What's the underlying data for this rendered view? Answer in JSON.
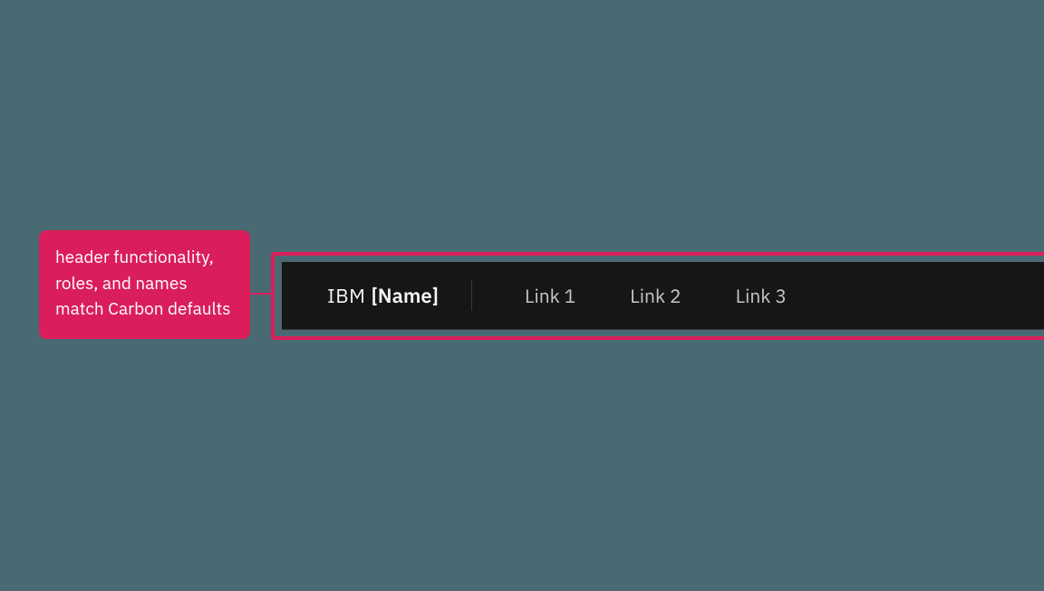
{
  "colors": {
    "accent": "#da1e5b",
    "background": "#4a6a73",
    "header_bg": "#161616",
    "nav_text": "#c6c6c6",
    "brand_text": "#f4f4f4"
  },
  "annotation": {
    "text": "header functionality, roles, and names match Carbon defaults"
  },
  "header": {
    "brand_prefix": "IBM",
    "brand_name": "[Name]",
    "nav": [
      {
        "label": "Link 1"
      },
      {
        "label": "Link 2"
      },
      {
        "label": "Link 3"
      }
    ]
  }
}
